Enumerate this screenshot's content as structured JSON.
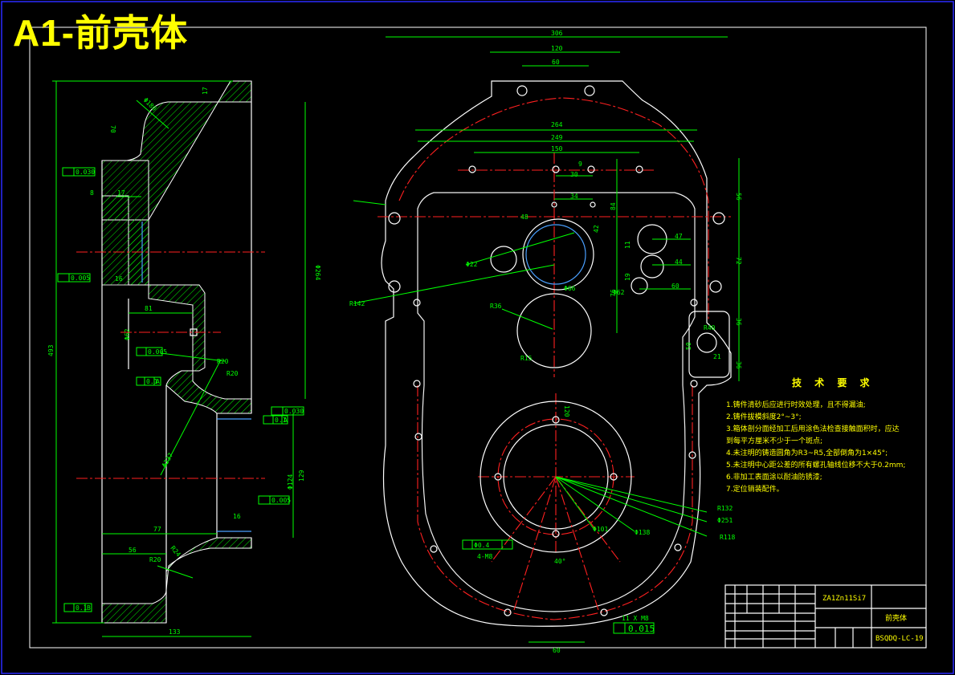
{
  "title_banner": "A1-前壳体",
  "left_view": {
    "dims": {
      "d70": "70",
      "d17": "17",
      "d493": "493",
      "d8": "8",
      "d17b": "17",
      "d16": "16",
      "d81": "81",
      "d264": "Φ264",
      "d77": "77",
      "d56": "56",
      "d133": "133",
      "d129": "129",
      "d16b": "16",
      "r20": "R20",
      "r20b": "R20",
      "r24": "R24",
      "r20c": "R20",
      "phi237": "Φ237",
      "phi180": "Φ180",
      "phi62": "Φ62",
      "phi124": "Φ124"
    },
    "tolerances": {
      "flat1": "0.030",
      "perp1": "0.005",
      "perp2": "0.005",
      "par1": "0.1",
      "par1_ref": "A",
      "flat2": "0.030",
      "par2": "0.1",
      "par2_ref": "A",
      "perp3": "0.005",
      "perp4": "0.1",
      "perp4_ref": "B"
    }
  },
  "front_view": {
    "dims": {
      "d306": "306",
      "d120": "120",
      "d60": "60",
      "d264": "264",
      "d249": "249",
      "d150": "150",
      "d30": "30",
      "d34": "34",
      "d84": "84",
      "d48": "48",
      "d42": "42",
      "d47": "47",
      "d44": "44",
      "d60b": "60",
      "d76": "76",
      "d56": "56",
      "d72": "72",
      "d36": "36",
      "d50": "50",
      "d21": "21",
      "d36b": "36",
      "d120b": "120",
      "d40": "40°",
      "d60c": "60",
      "d11": "11",
      "d19": "19",
      "d9": "9"
    },
    "labels": {
      "r142": "R142",
      "r36": "R36",
      "r15": "R15",
      "r40": "R40",
      "r132": "R132",
      "phi251": "Φ251",
      "r118": "R118",
      "phi138": "Φ138",
      "phi101": "Φ101",
      "phi22": "Φ22",
      "phi62": "Φ62",
      "phi66": "Φ66",
      "holes": "4-M8",
      "hole_pos": "Φ0.4",
      "thread": "11 X M8",
      "flat_tol": "0.015"
    }
  },
  "tech_requirements": {
    "title": "技 术 要 求",
    "items": [
      "1.铸件清砂后应进行时效处理，且不得漏油;",
      "2.铸件拔模斜度2°~3°;",
      "3.箱体剖分面经加工后用涂色法检查接触面积时，应达",
      "  到每平方厘米不少于一个斑点;",
      "4.未注明的铸造圆角为R3~R5,全部倒角为1×45°;",
      "5.未注明中心距公差的所有螺孔轴线位移不大于0.2mm;",
      "6.非加工表面涂以耐油防锈漆;",
      "7.定位销装配件。"
    ]
  },
  "title_block": {
    "material": "ZA1Zn11Si7",
    "part_name": "前壳体",
    "drawing_no": "BSQDQ-LC-19"
  },
  "colors": {
    "background": "#000000",
    "outline": "#ffffff",
    "dimension": "#00ff00",
    "centerline": "#ff2020",
    "text": "#ffff00",
    "border": "#2a2aff"
  }
}
